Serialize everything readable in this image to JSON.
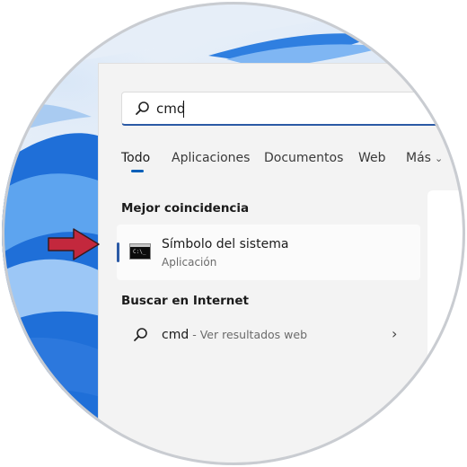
{
  "search": {
    "value": "cmd"
  },
  "tabs": [
    {
      "label": "Todo",
      "active": true
    },
    {
      "label": "Aplicaciones",
      "active": false
    },
    {
      "label": "Documentos",
      "active": false
    },
    {
      "label": "Web",
      "active": false
    },
    {
      "label": "Más",
      "active": false
    }
  ],
  "best_match": {
    "heading": "Mejor coincidencia",
    "title": "Símbolo del sistema",
    "subtitle": "Aplicación",
    "icon": "command-prompt-icon"
  },
  "internet": {
    "heading": "Buscar en Internet",
    "query": "cmd",
    "hint": " - Ver resultados web"
  },
  "colors": {
    "accent": "#005fb8",
    "arrow": "#c3283d",
    "panel": "#f3f3f3"
  }
}
